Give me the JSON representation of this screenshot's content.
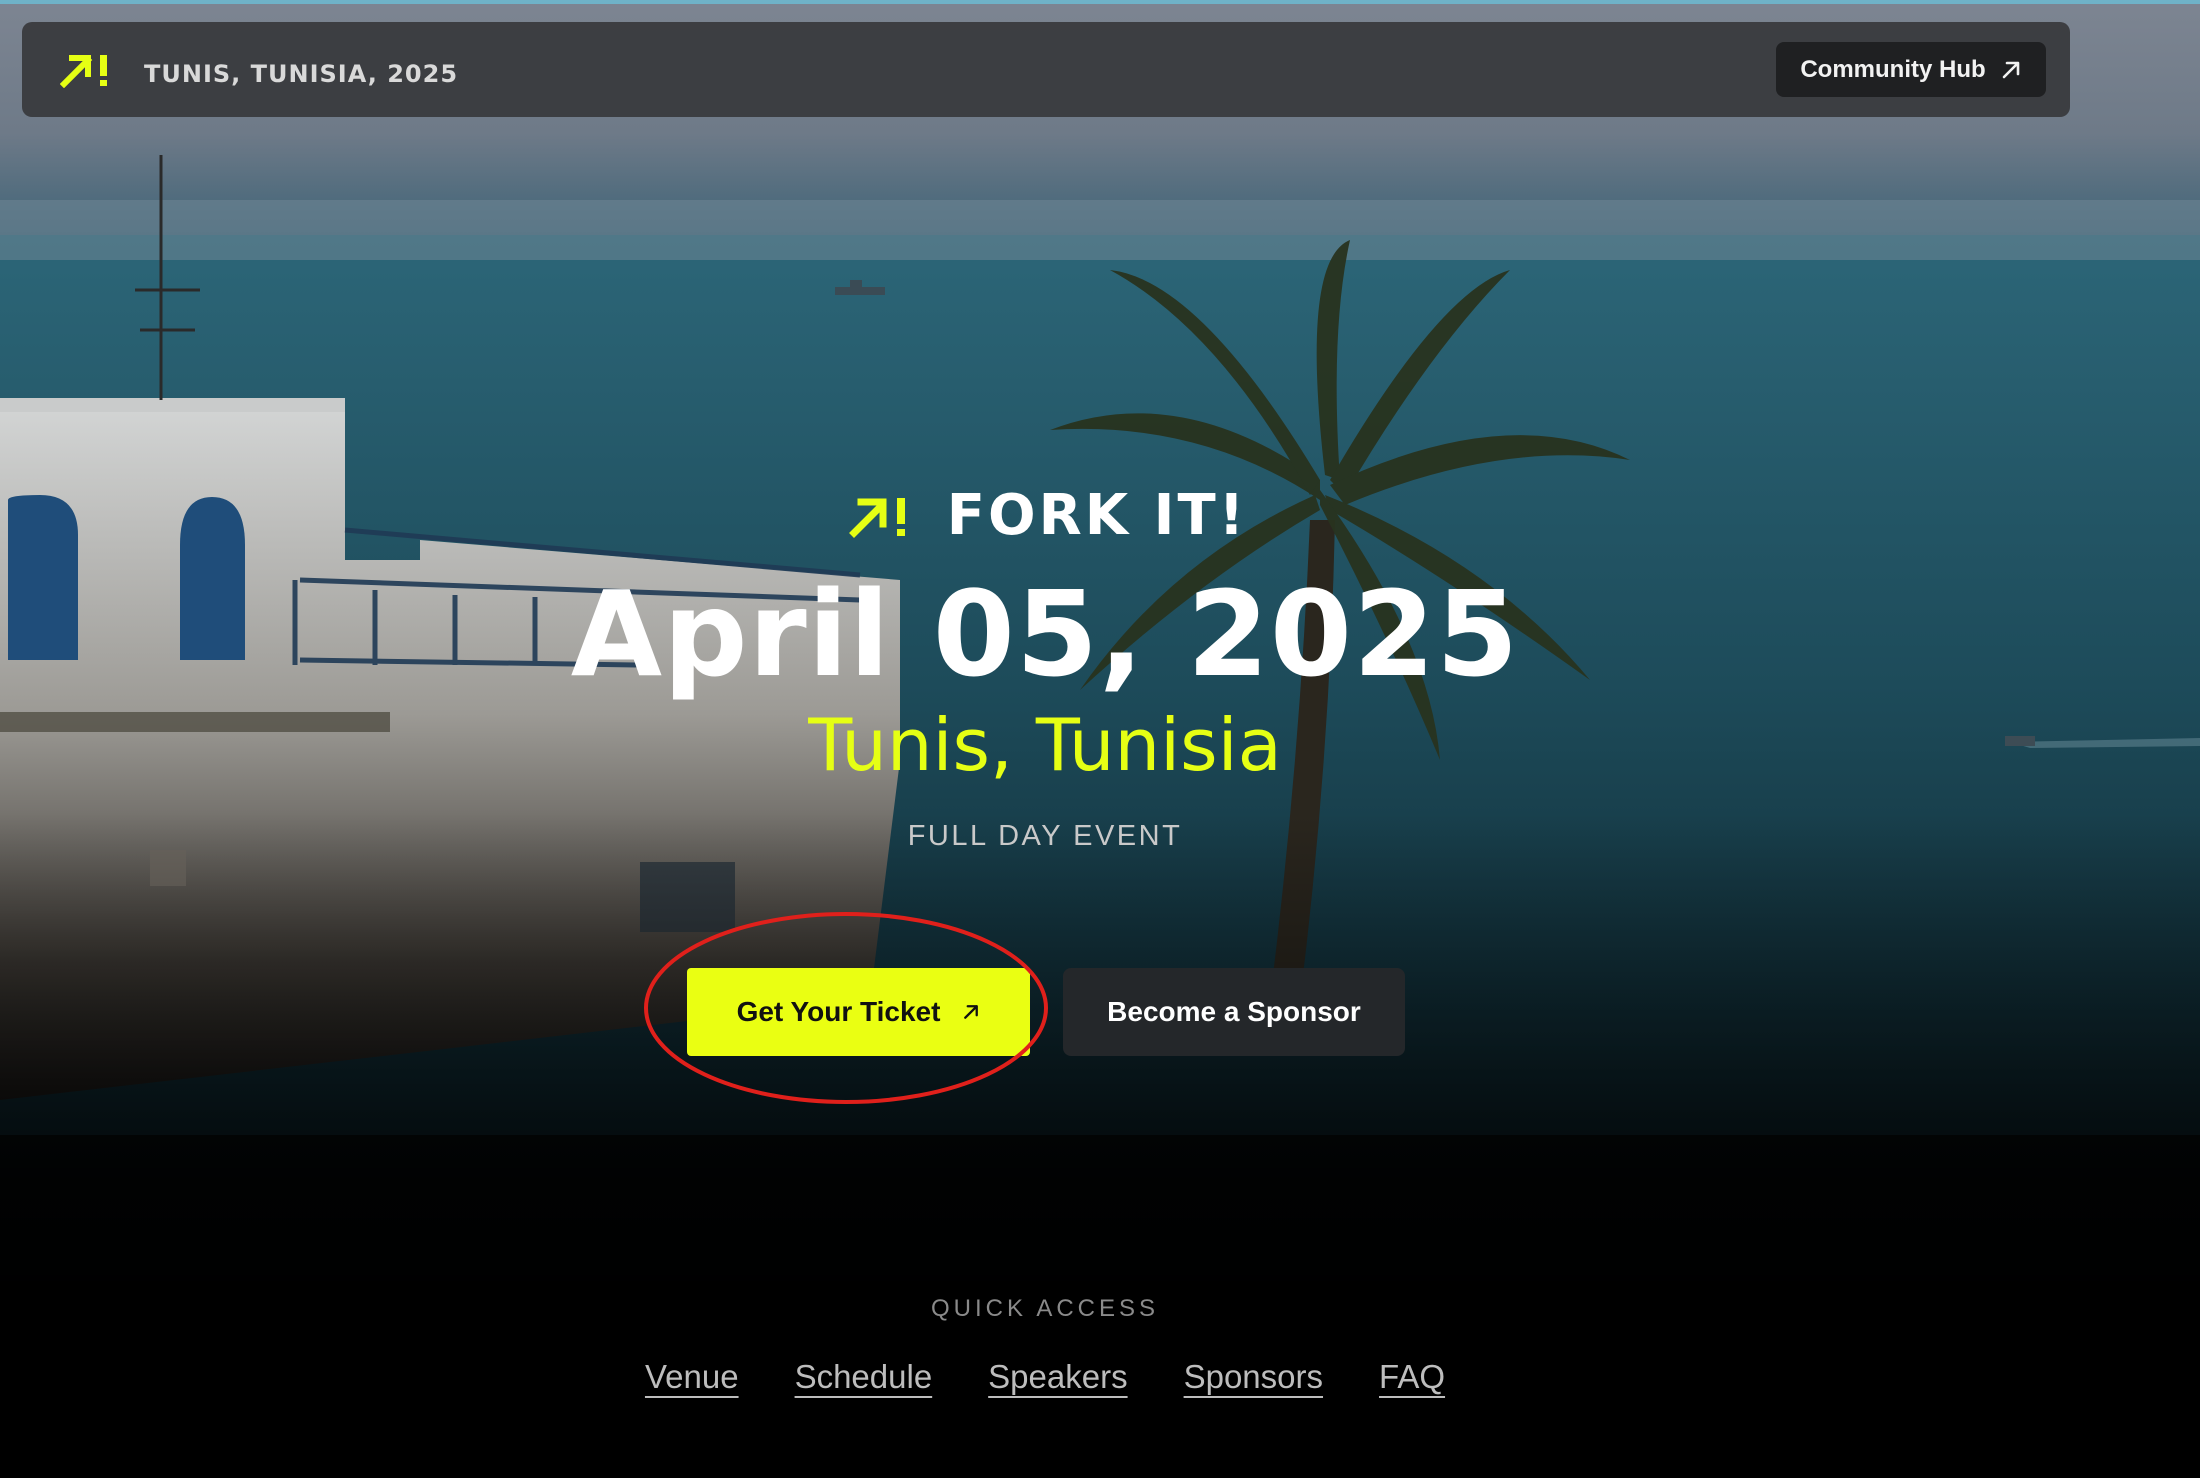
{
  "topbar": {
    "location": "TUNIS, TUNISIA, 2025",
    "community_label": "Community Hub"
  },
  "hero": {
    "brand_name": "FORK IT!",
    "date": "April 05, 2025",
    "city": "Tunis, Tunisia",
    "subtitle": "FULL DAY EVENT"
  },
  "actions": {
    "ticket_label": "Get Your Ticket",
    "sponsor_label": "Become a Sponsor"
  },
  "quick_access": {
    "title": "QUICK ACCESS",
    "links": [
      "Venue",
      "Schedule",
      "Speakers",
      "Sponsors",
      "FAQ"
    ]
  },
  "colors": {
    "accent": "#eaff12",
    "annotation_ring": "#e0201b"
  },
  "icons": {
    "brand": "fork-it-logo-icon",
    "external": "arrow-up-right-icon"
  }
}
